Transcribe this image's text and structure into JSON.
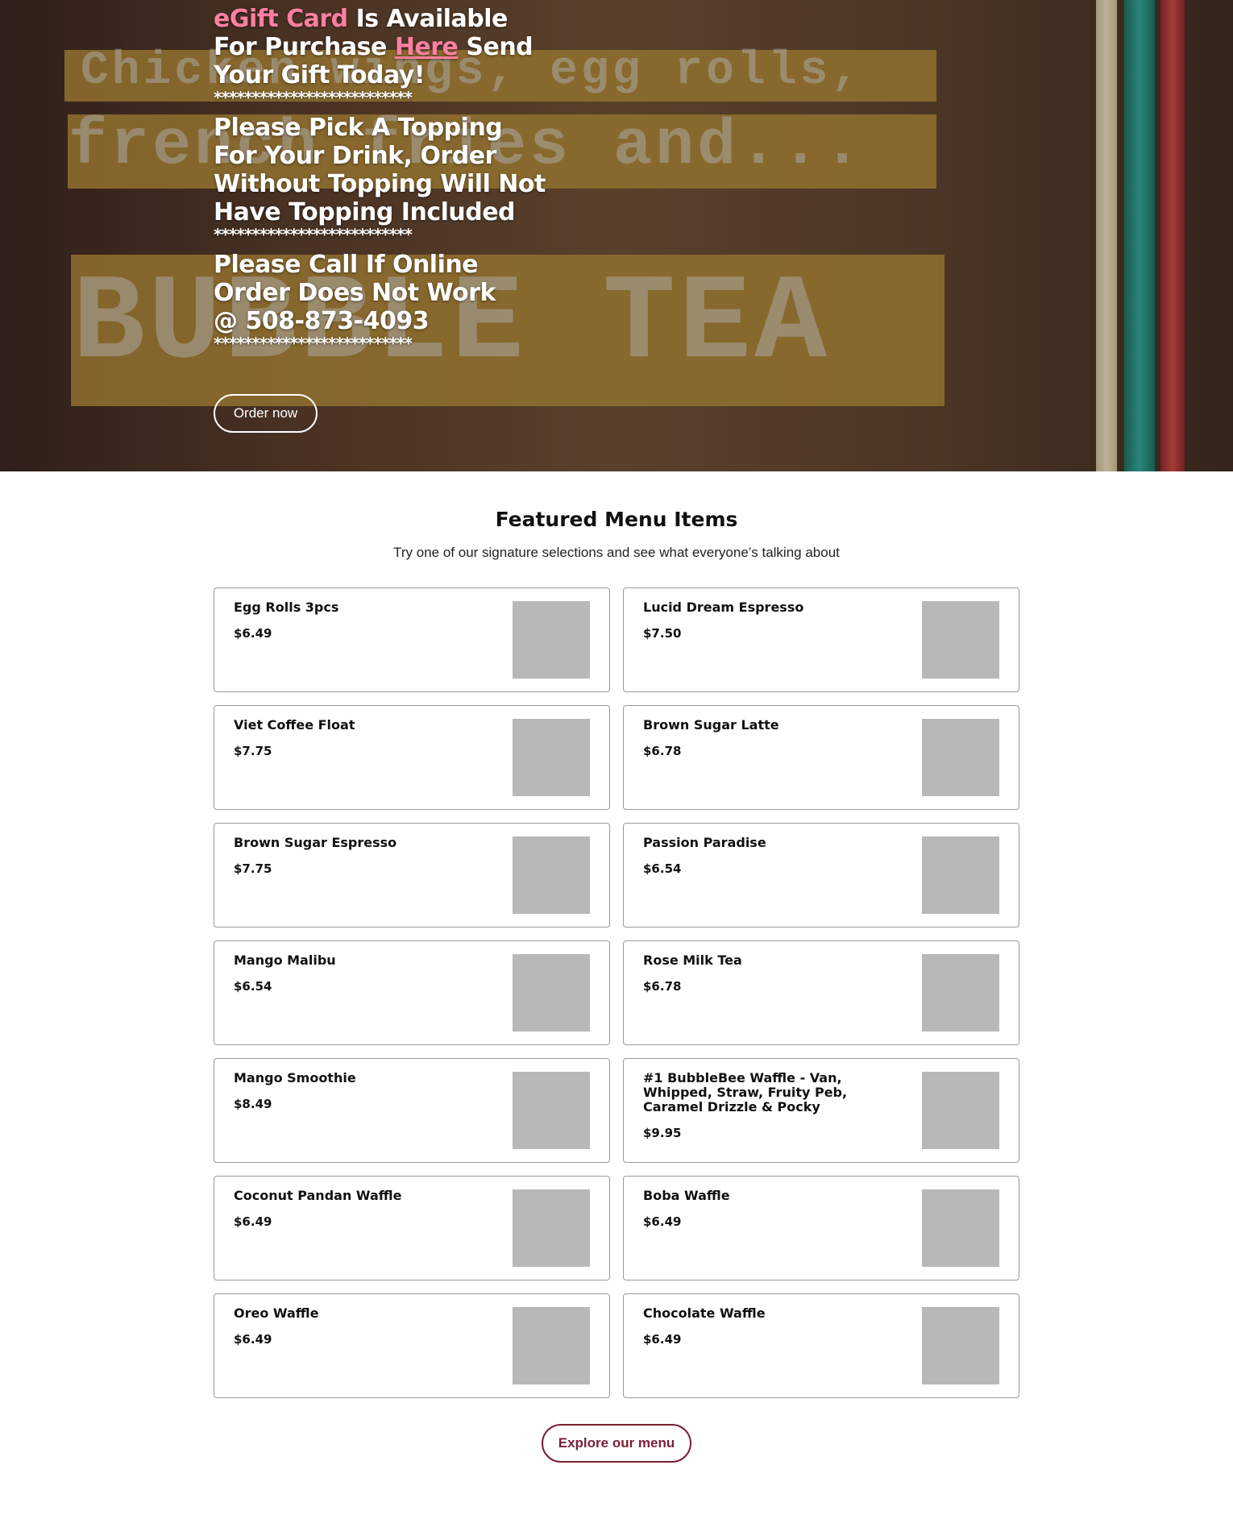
{
  "hero": {
    "gift_pink": "eGift Card",
    "gift_mid1": " Is Available For Purchase ",
    "gift_link": "Here",
    "gift_mid2": " Send Your Gift Today!",
    "stars": "**************************",
    "topping_text": "Please Pick A Topping For Your Drink, Order Without Topping Will Not Have Topping Included",
    "call_text1": "Please Call If Online Order Does Not Work",
    "call_text2": "@ 508-873-4093",
    "order_button": "Order now",
    "bg_band1": "Chicken wings, egg rolls,",
    "bg_band2": "french fries and...",
    "bg_band3": "BUBBLE TEA"
  },
  "featured": {
    "title": "Featured Menu Items",
    "subtitle": "Try one of our signature selections and see what everyone’s talking about",
    "items": [
      {
        "name": "Egg Rolls 3pcs",
        "price": "$6.49"
      },
      {
        "name": "Lucid Dream Espresso",
        "price": "$7.50"
      },
      {
        "name": "Viet Coffee Float",
        "price": "$7.75"
      },
      {
        "name": "Brown Sugar Latte",
        "price": "$6.78"
      },
      {
        "name": "Brown Sugar Espresso",
        "price": "$7.75"
      },
      {
        "name": "Passion Paradise",
        "price": "$6.54"
      },
      {
        "name": "Mango Malibu",
        "price": "$6.54"
      },
      {
        "name": "Rose Milk Tea",
        "price": "$6.78"
      },
      {
        "name": "Mango Smoothie",
        "price": "$8.49"
      },
      {
        "name": "#1 BubbleBee Waffle - Van, Whipped, Straw, Fruity Peb, Caramel Drizzle & Pocky",
        "price": "$9.95"
      },
      {
        "name": "Coconut Pandan Waffle",
        "price": "$6.49"
      },
      {
        "name": "Boba Waffle",
        "price": "$6.49"
      },
      {
        "name": "Oreo Waffle",
        "price": "$6.49"
      },
      {
        "name": "Chocolate Waffle",
        "price": "$6.49"
      }
    ],
    "explore_button": "Explore our menu"
  },
  "colors": {
    "pink_accent": "#ff7fa0",
    "brand_maroon": "#7a1f35",
    "placeholder_gray": "#b8b8b8"
  }
}
